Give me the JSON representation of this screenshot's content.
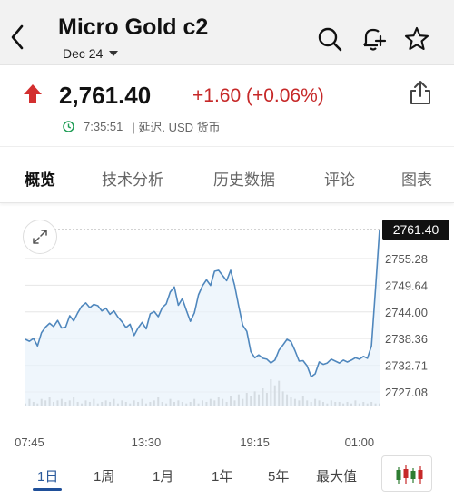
{
  "header": {
    "title": "Micro Gold c2",
    "contract": "Dec 24"
  },
  "quote": {
    "price": "2,761.40",
    "change": "+1.60 (+0.06%)",
    "time": "7:35:51",
    "delay_note": "| 延迟.  USD 货币"
  },
  "tabs": [
    "概览",
    "技术分析",
    "历史数据",
    "评论",
    "图表"
  ],
  "ranges": [
    "1日",
    "1周",
    "1月",
    "1年",
    "5年",
    "最大值"
  ],
  "colors": {
    "up": "#d32f2f",
    "line": "#4f87bd",
    "area": "#e8f2fb",
    "last_tag": "#111111",
    "active_range": "#2a5a9c"
  },
  "icons": {
    "back": "chevron-left-icon",
    "search": "search-icon",
    "alert": "bell-plus-icon",
    "watchlist": "star-icon",
    "share": "share-icon",
    "clock": "clock-icon",
    "expand": "expand-icon",
    "candles": "candlestick-icon"
  },
  "chart_data": {
    "type": "line",
    "x_ticks": [
      "07:45",
      "13:30",
      "19:15",
      "01:00"
    ],
    "y_ticks": [
      2755.28,
      2749.64,
      2744.0,
      2738.36,
      2732.71,
      2727.08
    ],
    "last_value": "2761.40",
    "ylim": [
      2724,
      2762
    ],
    "series": [
      {
        "values": [
          2738.2,
          2737.8,
          2738.4,
          2736.8,
          2739.6,
          2740.8,
          2741.6,
          2740.9,
          2742.2,
          2740.6,
          2740.8,
          2743.2,
          2742.1,
          2743.8,
          2745.2,
          2745.9,
          2744.9,
          2745.6,
          2745.3,
          2744.2,
          2744.8,
          2743.5,
          2744.2,
          2742.9,
          2741.9,
          2740.7,
          2741.4,
          2739.0,
          2740.6,
          2741.8,
          2740.4,
          2743.6,
          2744.1,
          2743.0,
          2744.9,
          2745.7,
          2748.2,
          2749.3,
          2745.4,
          2746.8,
          2744.3,
          2742.0,
          2743.8,
          2747.6,
          2749.5,
          2750.8,
          2749.6,
          2752.6,
          2752.8,
          2751.7,
          2750.6,
          2752.8,
          2749.5,
          2745.2,
          2741.2,
          2739.9,
          2735.6,
          2734.3,
          2734.9,
          2734.2,
          2734.0,
          2733.2,
          2733.8,
          2735.9,
          2737.0,
          2738.2,
          2737.7,
          2735.8,
          2733.6,
          2733.7,
          2732.6,
          2730.3,
          2730.9,
          2733.4,
          2732.9,
          2733.2,
          2734.0,
          2733.6,
          2733.2,
          2733.8,
          2733.4,
          2733.8,
          2734.3,
          2734.0,
          2734.6,
          2734.2,
          2736.8,
          2749.0,
          2761.4
        ]
      }
    ],
    "volume": [
      2,
      5,
      3,
      2,
      5,
      4,
      6,
      3,
      4,
      5,
      3,
      4,
      6,
      3,
      2,
      4,
      3,
      5,
      2,
      3,
      4,
      3,
      5,
      2,
      4,
      3,
      2,
      4,
      3,
      5,
      2,
      3,
      4,
      6,
      3,
      2,
      5,
      3,
      4,
      3,
      2,
      3,
      5,
      2,
      4,
      3,
      5,
      4,
      6,
      5,
      3,
      7,
      4,
      8,
      5,
      9,
      7,
      10,
      8,
      12,
      9,
      18,
      14,
      17,
      10,
      8,
      6,
      5,
      4,
      7,
      4,
      3,
      5,
      4,
      3,
      2,
      4,
      3,
      3,
      2,
      3,
      2,
      4,
      2,
      3,
      2,
      3,
      2,
      2
    ],
    "grid": true
  }
}
